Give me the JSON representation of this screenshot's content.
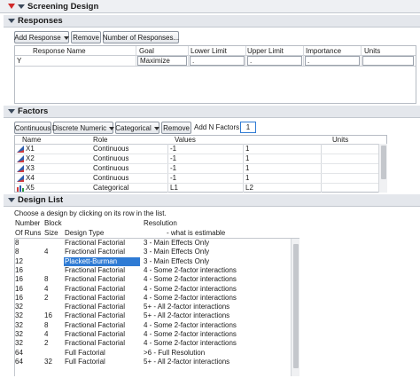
{
  "window": {
    "title": "Screening Design"
  },
  "responses": {
    "title": "Responses",
    "buttons": {
      "add_response": "Add Response",
      "remove": "Remove",
      "number_of_responses": "Number of Responses..."
    },
    "columns": [
      "Response Name",
      "Goal",
      "Lower Limit",
      "Upper Limit",
      "Importance",
      "Units"
    ],
    "rows": [
      {
        "name": "Y",
        "goal": "Maximize",
        "lower": ".",
        "upper": ".",
        "importance": ".",
        "units": ""
      }
    ]
  },
  "factors": {
    "title": "Factors",
    "buttons": {
      "continuous": "Continuous",
      "discrete_numeric": "Discrete Numeric",
      "categorical": "Categorical",
      "remove": "Remove"
    },
    "add_n_label": "Add N Factors",
    "add_n_value": "1",
    "columns": [
      "Name",
      "Role",
      "Values",
      "Units"
    ],
    "rows": [
      {
        "name": "X1",
        "role": "Continuous",
        "v1": "-1",
        "v2": "1",
        "icon": "continuous-factor-icon"
      },
      {
        "name": "X2",
        "role": "Continuous",
        "v1": "-1",
        "v2": "1",
        "icon": "continuous-factor-icon"
      },
      {
        "name": "X3",
        "role": "Continuous",
        "v1": "-1",
        "v2": "1",
        "icon": "continuous-factor-icon"
      },
      {
        "name": "X4",
        "role": "Continuous",
        "v1": "-1",
        "v2": "1",
        "icon": "continuous-factor-icon"
      },
      {
        "name": "X5",
        "role": "Categorical",
        "v1": "L1",
        "v2": "L2",
        "icon": "categorical-factor-icon"
      }
    ]
  },
  "design_list": {
    "title": "Design List",
    "instruction": "Choose a design by clicking on its row in the list.",
    "header_top": {
      "number": "Number",
      "block": "Block",
      "resolution": "Resolution"
    },
    "header_bottom": {
      "runs": "Of Runs",
      "size": "Size",
      "design_type": "Design Type",
      "estimable": "- what is estimable"
    },
    "rows": [
      {
        "runs": "8",
        "block": "",
        "type": "Fractional Factorial",
        "res": "3 - Main Effects Only"
      },
      {
        "runs": "8",
        "block": "4",
        "type": "Fractional Factorial",
        "res": "3 - Main Effects Only"
      },
      {
        "runs": "12",
        "block": "",
        "type": "Plackett-Burman",
        "res": "3 - Main Effects Only"
      },
      {
        "runs": "16",
        "block": "",
        "type": "Fractional Factorial",
        "res": "4 - Some 2-factor interactions"
      },
      {
        "runs": "16",
        "block": "8",
        "type": "Fractional Factorial",
        "res": "4 - Some 2-factor interactions"
      },
      {
        "runs": "16",
        "block": "4",
        "type": "Fractional Factorial",
        "res": "4 - Some 2-factor interactions"
      },
      {
        "runs": "16",
        "block": "2",
        "type": "Fractional Factorial",
        "res": "4 - Some 2-factor interactions"
      },
      {
        "runs": "32",
        "block": "",
        "type": "Fractional Factorial",
        "res": "5+ - All 2-factor interactions"
      },
      {
        "runs": "32",
        "block": "16",
        "type": "Fractional Factorial",
        "res": "5+ - All 2-factor interactions"
      },
      {
        "runs": "32",
        "block": "8",
        "type": "Fractional Factorial",
        "res": "4 - Some 2-factor interactions"
      },
      {
        "runs": "32",
        "block": "4",
        "type": "Fractional Factorial",
        "res": "4 - Some 2-factor interactions"
      },
      {
        "runs": "32",
        "block": "2",
        "type": "Fractional Factorial",
        "res": "4 - Some 2-factor interactions"
      },
      {
        "runs": "64",
        "block": "",
        "type": "Full Factorial",
        "res": ">6 - Full Resolution"
      },
      {
        "runs": "64",
        "block": "32",
        "type": "Full Factorial",
        "res": "5+ - All 2-factor interactions"
      }
    ],
    "selected_index": 2
  },
  "colors": {
    "selection": "#2f7bd4",
    "header_bg": "#e4e7ec",
    "red_triangle": "#d12a2a"
  }
}
